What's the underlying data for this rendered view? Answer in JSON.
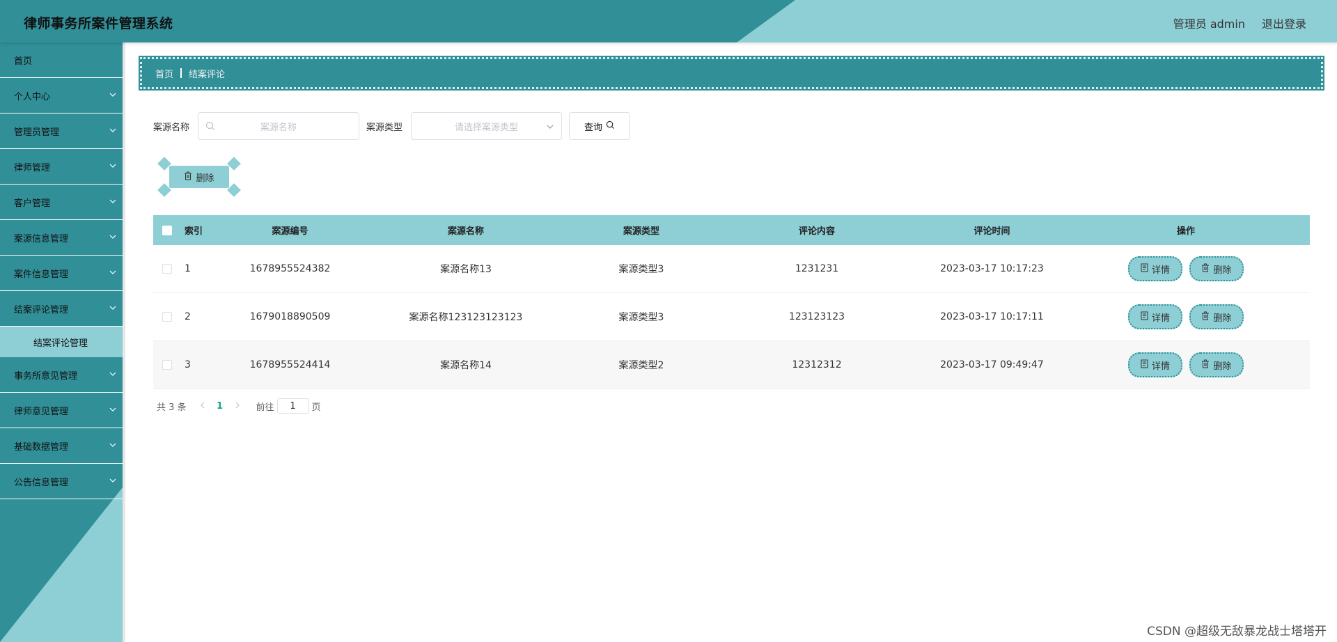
{
  "app": {
    "title": "律师事务所案件管理系统"
  },
  "header": {
    "user": "管理员 admin",
    "logout": "退出登录"
  },
  "sidebar": {
    "items": [
      {
        "label": "首页",
        "chevron": false
      },
      {
        "label": "个人中心",
        "chevron": true
      },
      {
        "label": "管理员管理",
        "chevron": true
      },
      {
        "label": "律师管理",
        "chevron": true
      },
      {
        "label": "客户管理",
        "chevron": true
      },
      {
        "label": "案源信息管理",
        "chevron": true
      },
      {
        "label": "案件信息管理",
        "chevron": true
      },
      {
        "label": "结案评论管理",
        "chevron": true
      },
      {
        "label": "事务所意见管理",
        "chevron": true
      },
      {
        "label": "律师意见管理",
        "chevron": true
      },
      {
        "label": "基础数据管理",
        "chevron": true
      },
      {
        "label": "公告信息管理",
        "chevron": true
      }
    ],
    "subitem": {
      "label": "结案评论管理"
    }
  },
  "breadcrumb": {
    "home": "首页",
    "current": "结案评论"
  },
  "search": {
    "name_label": "案源名称",
    "name_placeholder": "案源名称",
    "type_label": "案源类型",
    "type_placeholder": "请选择案源类型",
    "query_label": "查询"
  },
  "actions": {
    "batch_delete": "删除"
  },
  "table": {
    "headers": {
      "index": "索引",
      "code": "案源编号",
      "name": "案源名称",
      "type": "案源类型",
      "content": "评论内容",
      "time": "评论时间",
      "ops": "操作"
    },
    "rows": [
      {
        "index": "1",
        "code": "1678955524382",
        "name": "案源名称13",
        "type": "案源类型3",
        "content": "1231231",
        "time": "2023-03-17 10:17:23"
      },
      {
        "index": "2",
        "code": "1679018890509",
        "name": "案源名称123123123123",
        "type": "案源类型3",
        "content": "123123123",
        "time": "2023-03-17 10:17:11"
      },
      {
        "index": "3",
        "code": "1678955524414",
        "name": "案源名称14",
        "type": "案源类型2",
        "content": "12312312",
        "time": "2023-03-17 09:49:47"
      }
    ],
    "detail_label": "详情",
    "delete_label": "删除"
  },
  "pagination": {
    "total": "共 3 条",
    "current_page": "1",
    "goto_prefix": "前往",
    "goto_value": "1",
    "goto_suffix": "页"
  },
  "watermark": "CSDN @超级无敌暴龙战士塔塔开",
  "colors": {
    "primary_teal": "#318f98",
    "light_teal": "#8ecfd6",
    "pagination_active": "#1a9f8f"
  },
  "icons": {
    "search": "search-icon",
    "dropdown": "chevron-down-icon",
    "delete": "trash-icon",
    "detail": "document-icon"
  }
}
